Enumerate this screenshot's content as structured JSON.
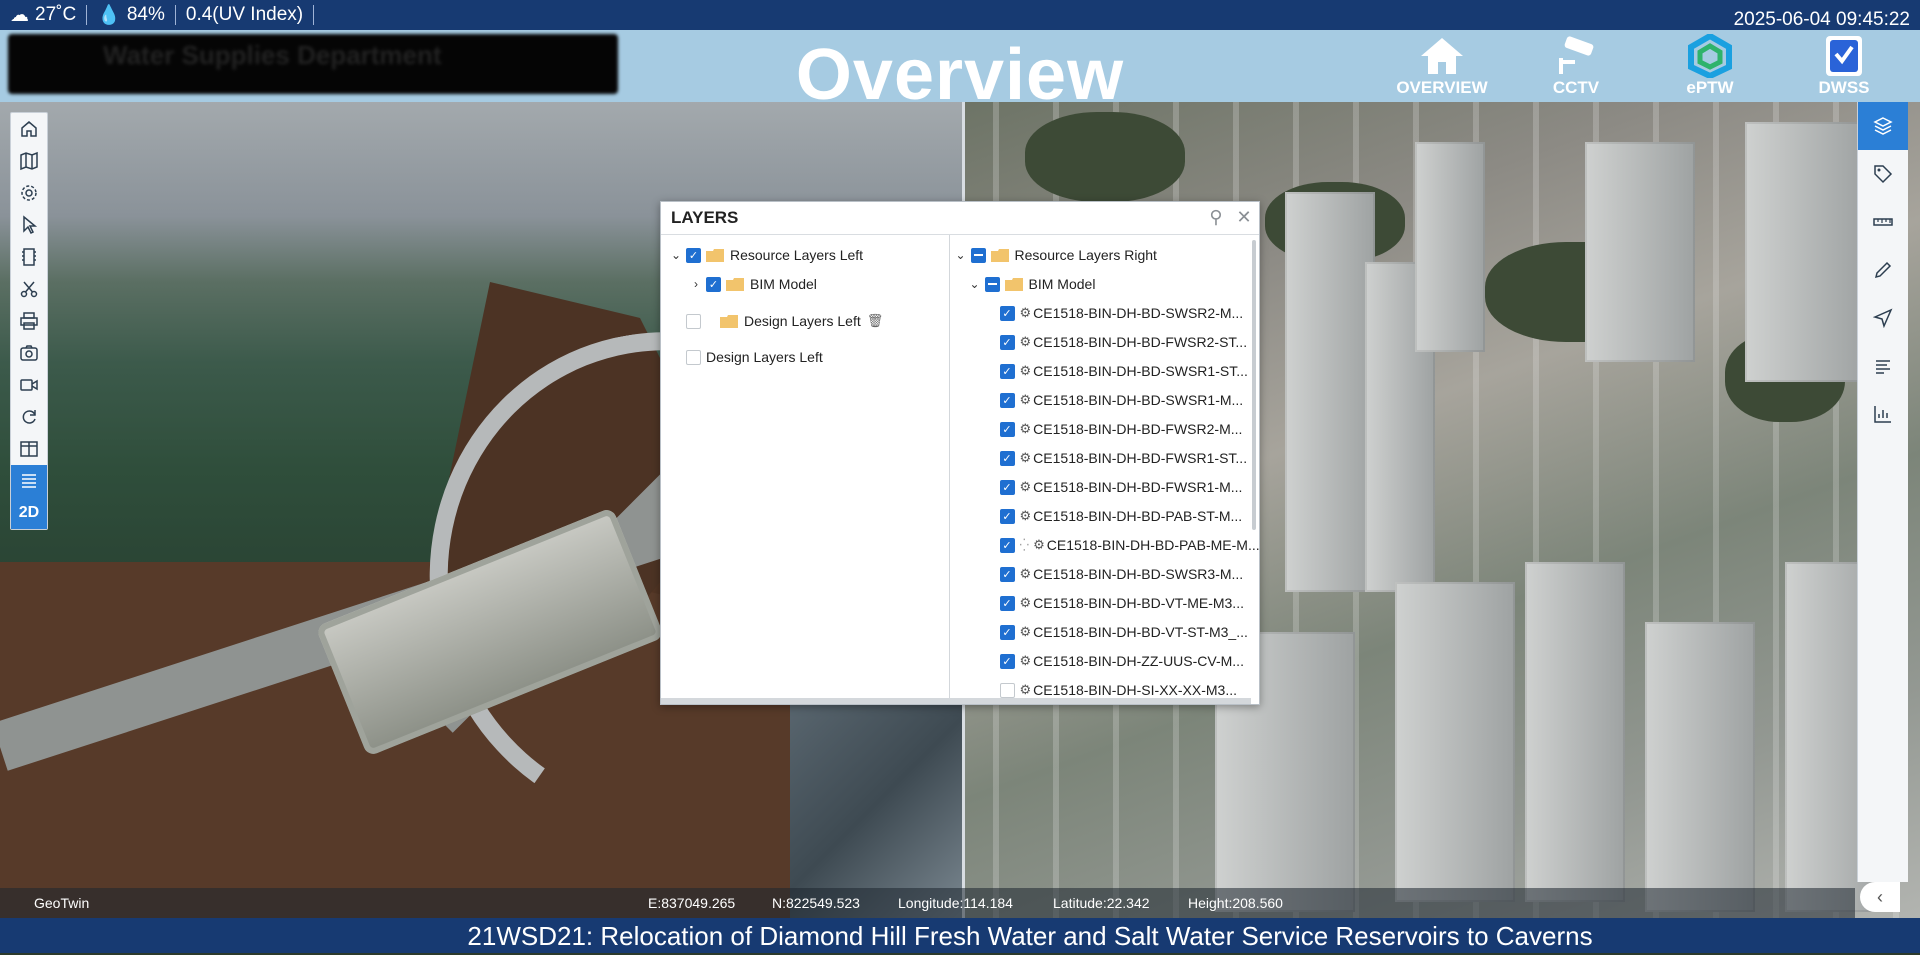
{
  "weather": {
    "temperature": "27˚C",
    "humidity": "84%",
    "uv": "0.4(UV Index)"
  },
  "clock": "2025-06-04 09:45:22",
  "header": {
    "org_name": "Water Supplies Department",
    "title": "Overview",
    "nav": [
      {
        "label": "OVERVIEW",
        "icon": "home-icon"
      },
      {
        "label": "CCTV",
        "icon": "cctv-icon"
      },
      {
        "label": "ePTW",
        "icon": "eptw-icon"
      },
      {
        "label": "DWSS",
        "icon": "dwss-icon"
      }
    ]
  },
  "left_toolbar": {
    "items": [
      "home-icon",
      "map-icon",
      "settings-icon",
      "cursor-icon",
      "film-icon",
      "scissors-icon",
      "print-icon",
      "camera-icon",
      "video-icon",
      "refresh-icon",
      "split-view-icon",
      "layers-list-icon"
    ],
    "active_item": "layers-list-icon",
    "mode_label": "2D"
  },
  "right_toolbar": {
    "items": [
      "layers-icon",
      "tag-icon",
      "ruler-icon",
      "pencil-icon",
      "send-icon",
      "list-icon",
      "chart-icon"
    ],
    "active_item": "layers-icon"
  },
  "layers_panel": {
    "title": "LAYERS",
    "left": {
      "root_label": "Resource Layers Left",
      "bim_label": "BIM Model",
      "design_label": "Design Layers Left",
      "design_label2": "Design Layers Left"
    },
    "right": {
      "root_label": "Resource Layers Right",
      "bim_label": "BIM Model",
      "items": [
        "CE1518-BIN-DH-BD-SWSR2-M...",
        "CE1518-BIN-DH-BD-FWSR2-ST...",
        "CE1518-BIN-DH-BD-SWSR1-ST...",
        "CE1518-BIN-DH-BD-SWSR1-M...",
        "CE1518-BIN-DH-BD-FWSR2-M...",
        "CE1518-BIN-DH-BD-FWSR1-ST...",
        "CE1518-BIN-DH-BD-FWSR1-M...",
        "CE1518-BIN-DH-BD-PAB-ST-M...",
        "CE1518-BIN-DH-BD-PAB-ME-M...",
        "CE1518-BIN-DH-BD-SWSR3-M...",
        "CE1518-BIN-DH-BD-VT-ME-M3...",
        "CE1518-BIN-DH-BD-VT-ST-M3_...",
        "CE1518-BIN-DH-ZZ-UUS-CV-M...",
        "CE1518-BIN-DH-SI-XX-XX-M3..."
      ]
    }
  },
  "status": {
    "brand": "GeoTwin",
    "easting": "E:837049.265",
    "northing": "N:822549.523",
    "longitude": "Longitude:114.184",
    "latitude": "Latitude:22.342",
    "height": "Height:208.560"
  },
  "project_title": "21WSD21: Relocation of Diamond Hill Fresh Water and Salt Water Service Reservoirs to Caverns"
}
